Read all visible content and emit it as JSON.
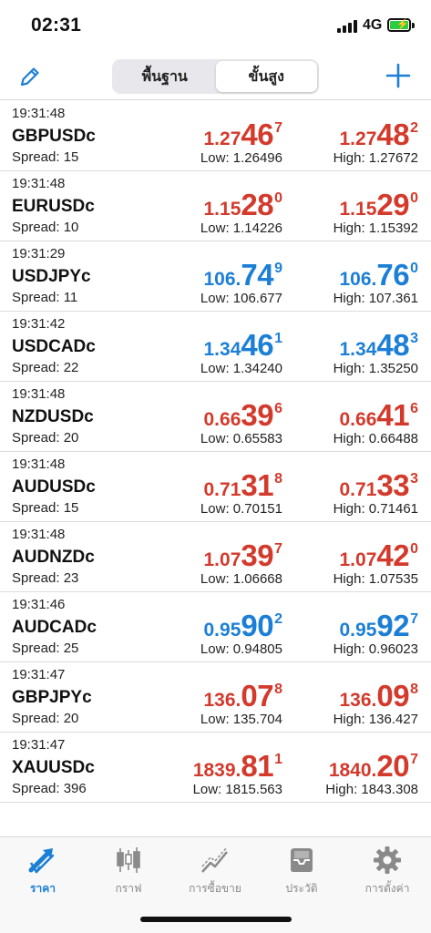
{
  "status_bar": {
    "time": "02:31",
    "network": "4G",
    "battery_color": "#2ecc40"
  },
  "toolbar": {
    "edit_icon": "pencil-icon",
    "segments": [
      {
        "label": "พื้นฐาน",
        "active": false
      },
      {
        "label": "ขั้นสูง",
        "active": true
      }
    ],
    "add_icon": "plus-icon",
    "accent_color": "#1c7fd6"
  },
  "quotes": [
    {
      "time": "19:31:48",
      "symbol": "GBPUSDc",
      "spread": "Spread: 15",
      "color": "red",
      "bid": {
        "small": "1.27",
        "big": "46",
        "sup": "7"
      },
      "ask": {
        "small": "1.27",
        "big": "48",
        "sup": "2"
      },
      "low": "Low: 1.26496",
      "high": "High: 1.27672"
    },
    {
      "time": "19:31:48",
      "symbol": "EURUSDc",
      "spread": "Spread: 10",
      "color": "red",
      "bid": {
        "small": "1.15",
        "big": "28",
        "sup": "0"
      },
      "ask": {
        "small": "1.15",
        "big": "29",
        "sup": "0"
      },
      "low": "Low: 1.14226",
      "high": "High: 1.15392"
    },
    {
      "time": "19:31:29",
      "symbol": "USDJPYc",
      "spread": "Spread: 11",
      "color": "blue",
      "bid": {
        "small": "106.",
        "big": "74",
        "sup": "9"
      },
      "ask": {
        "small": "106.",
        "big": "76",
        "sup": "0"
      },
      "low": "Low: 106.677",
      "high": "High: 107.361"
    },
    {
      "time": "19:31:42",
      "symbol": "USDCADc",
      "spread": "Spread: 22",
      "color": "blue",
      "bid": {
        "small": "1.34",
        "big": "46",
        "sup": "1"
      },
      "ask": {
        "small": "1.34",
        "big": "48",
        "sup": "3"
      },
      "low": "Low: 1.34240",
      "high": "High: 1.35250"
    },
    {
      "time": "19:31:48",
      "symbol": "NZDUSDc",
      "spread": "Spread: 20",
      "color": "red",
      "bid": {
        "small": "0.66",
        "big": "39",
        "sup": "6"
      },
      "ask": {
        "small": "0.66",
        "big": "41",
        "sup": "6"
      },
      "low": "Low: 0.65583",
      "high": "High: 0.66488"
    },
    {
      "time": "19:31:48",
      "symbol": "AUDUSDc",
      "spread": "Spread: 15",
      "color": "red",
      "bid": {
        "small": "0.71",
        "big": "31",
        "sup": "8"
      },
      "ask": {
        "small": "0.71",
        "big": "33",
        "sup": "3"
      },
      "low": "Low: 0.70151",
      "high": "High: 0.71461"
    },
    {
      "time": "19:31:48",
      "symbol": "AUDNZDc",
      "spread": "Spread: 23",
      "color": "red",
      "bid": {
        "small": "1.07",
        "big": "39",
        "sup": "7"
      },
      "ask": {
        "small": "1.07",
        "big": "42",
        "sup": "0"
      },
      "low": "Low: 1.06668",
      "high": "High: 1.07535"
    },
    {
      "time": "19:31:46",
      "symbol": "AUDCADc",
      "spread": "Spread: 25",
      "color": "blue",
      "bid": {
        "small": "0.95",
        "big": "90",
        "sup": "2"
      },
      "ask": {
        "small": "0.95",
        "big": "92",
        "sup": "7"
      },
      "low": "Low: 0.94805",
      "high": "High: 0.96023"
    },
    {
      "time": "19:31:47",
      "symbol": "GBPJPYc",
      "spread": "Spread: 20",
      "color": "red",
      "bid": {
        "small": "136.",
        "big": "07",
        "sup": "8"
      },
      "ask": {
        "small": "136.",
        "big": "09",
        "sup": "8"
      },
      "low": "Low: 135.704",
      "high": "High: 136.427"
    },
    {
      "time": "19:31:47",
      "symbol": "XAUUSDc",
      "spread": "Spread: 396",
      "color": "red",
      "bid": {
        "small": "1839.",
        "big": "81",
        "sup": "1"
      },
      "ask": {
        "small": "1840.",
        "big": "20",
        "sup": "7"
      },
      "low": "Low: 1815.563",
      "high": "High: 1843.308"
    }
  ],
  "colors": {
    "up": "#1c7fd6",
    "down": "#d33a2c"
  },
  "tab_bar": {
    "tabs": [
      {
        "label": "ราคา",
        "icon": "quotes-arrows-icon",
        "active": true
      },
      {
        "label": "กราฟ",
        "icon": "candlestick-chart-icon",
        "active": false
      },
      {
        "label": "การซื้อขาย",
        "icon": "trade-chart-icon",
        "active": false
      },
      {
        "label": "ประวัติ",
        "icon": "history-inbox-icon",
        "active": false
      },
      {
        "label": "การตั้งค่า",
        "icon": "settings-gear-icon",
        "active": false
      }
    ]
  }
}
